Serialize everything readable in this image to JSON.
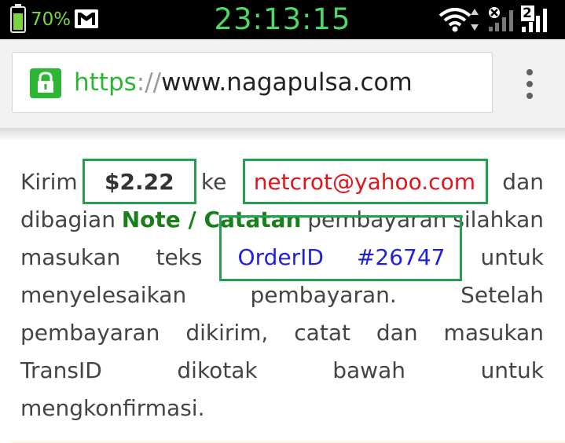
{
  "status_bar": {
    "battery_percent": "70%",
    "battery_level": 0.7,
    "time": "23:13:15",
    "notification_icon": "gmail-icon",
    "sim2_label": "2",
    "icons": [
      "battery-icon",
      "gmail-icon",
      "wifi-icon",
      "data-arrows-icon",
      "signal-sim1-icon",
      "signal-sim2-icon"
    ]
  },
  "browser": {
    "url_scheme": "https",
    "url_separator": "://",
    "url_host": "www.nagapulsa.com",
    "lock_icon": "lock-icon",
    "menu_icon": "overflow-menu-icon"
  },
  "instructions": {
    "line1": {
      "w1": "Kirim",
      "amount": "$2.22",
      "w2": "ke",
      "email": "netcrot@yahoo.com",
      "w3": "dan"
    },
    "line2": {
      "w1": "dibagian",
      "note": "Note / Catatan",
      "w2": "pembayaran",
      "w3": "silahkan"
    },
    "line3": {
      "w1": "masukan",
      "w2": "teks",
      "order_label": "OrderID",
      "order_number": "#26747",
      "w3": "untuk"
    },
    "line4": {
      "w1": "menyelesaikan",
      "w2": "pembayaran.",
      "w3": "Setelah"
    },
    "line5": {
      "w1": "pembayaran",
      "w2": "dikirim,",
      "w3": "catat",
      "w4": "dan",
      "w5": "masukan"
    },
    "line6": {
      "w1": "TransID",
      "w2": "dikotak",
      "w3": "bawah",
      "w4": "untuk"
    },
    "line7": {
      "w1": "mengkonfirmasi."
    }
  },
  "colors": {
    "highlight_border": "#26a050",
    "amount_text": "#333333",
    "email_text": "#e0151b",
    "order_text": "#1f1fe0",
    "note_text": "#1a7f1a",
    "secure_scheme": "#2db535",
    "clock": "#4cd964"
  }
}
